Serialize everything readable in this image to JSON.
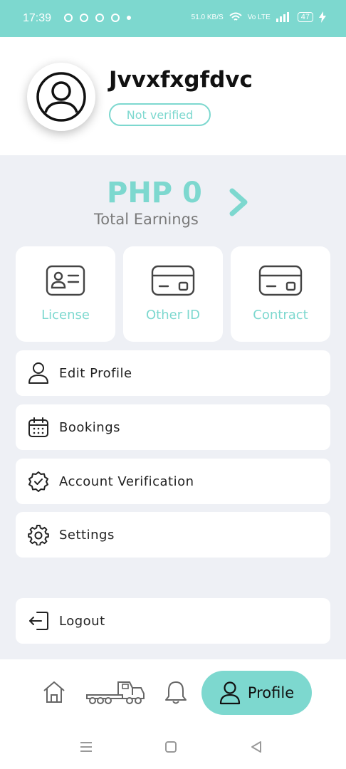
{
  "status_bar": {
    "time": "17:39",
    "network_speed": "51.0",
    "network_unit": "KB/S",
    "carrier": "Vo LTE",
    "battery": "47"
  },
  "profile": {
    "username": "Jvvxfxgfdvc",
    "verification_status": "Not verified"
  },
  "earnings": {
    "amount": "PHP 0",
    "label": "Total Earnings"
  },
  "documents": [
    {
      "label": "License",
      "icon": "id-card-icon"
    },
    {
      "label": "Other ID",
      "icon": "card-icon"
    },
    {
      "label": "Contract",
      "icon": "card-icon"
    }
  ],
  "menu": {
    "edit_profile": "Edit Profile",
    "bookings": "Bookings",
    "account_verification": "Account Verification",
    "settings": "Settings",
    "logout": "Logout"
  },
  "bottom_nav": {
    "active_label": "Profile"
  },
  "colors": {
    "accent": "#7dd8cf",
    "background": "#eef0f5",
    "card": "#ffffff",
    "text": "#222222",
    "muted": "#7a7a7a"
  }
}
